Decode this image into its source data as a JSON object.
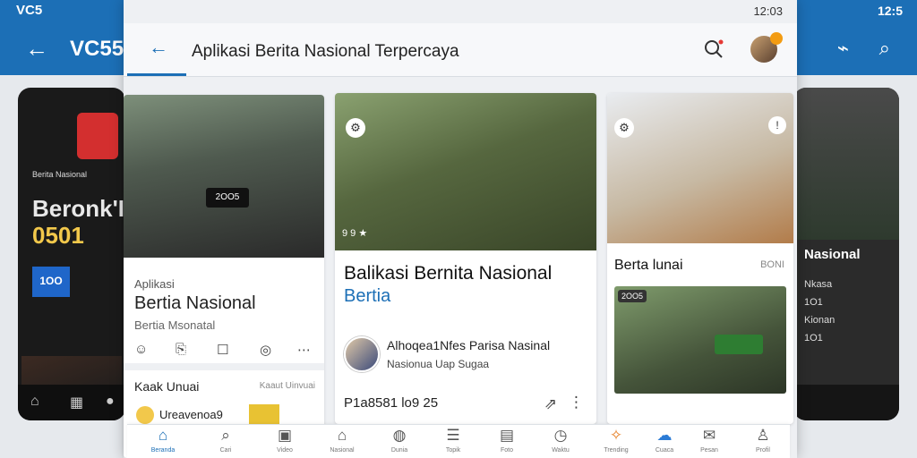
{
  "background_app": {
    "status_left": "VC5",
    "status_right": "12:5",
    "title": "VC55",
    "left_phone": {
      "brand_line": "Berita Nasional",
      "big_text_1": "Beronk'I",
      "big_text_2": "0501",
      "tag": "1OO"
    },
    "right_phone": {
      "title": "Nasional",
      "lines": [
        "Nkasa",
        "1O1",
        "Kionan",
        "1O1"
      ]
    }
  },
  "status": {
    "time": "12:03"
  },
  "header": {
    "title": "Aplikasi Berita Nasional Terpercaya"
  },
  "cards": {
    "left": {
      "screen_text": "2OO5",
      "kicker": "Aplikasi",
      "title": "Bertia Nasional",
      "subtitle": "Bertia Msonatal",
      "section_title": "Kaak Unuai",
      "section_right": "Kaaut Uinvuai",
      "item_text": "Ureavenoa9"
    },
    "middle": {
      "mini_overlay": "9 9 ★",
      "headline": "Balikasi Bernita Nasional",
      "headline_sub": "Bertia",
      "author_line_1": "Alhoqea1Nfes Parisa Nasinal",
      "author_line_2": "Nasionua Uap Sugaa",
      "meta": "P1a8581 lo9 25"
    },
    "right": {
      "heading": "Berta lunai",
      "heading_right": "BONI",
      "chip": "2OO5"
    }
  },
  "tabbar": {
    "items": [
      {
        "label": "Beranda",
        "icon": "home-icon"
      },
      {
        "label": "Cari",
        "icon": "search-icon"
      },
      {
        "label": "Video",
        "icon": "video-icon"
      },
      {
        "label": "Nasional",
        "icon": "landmark-icon"
      },
      {
        "label": "Dunia",
        "icon": "globe-icon"
      },
      {
        "label": "Topik",
        "icon": "list-icon"
      },
      {
        "label": "Foto",
        "icon": "photo-icon"
      },
      {
        "label": "Waktu",
        "icon": "clock-icon"
      },
      {
        "label": "Trending",
        "icon": "trend-icon"
      },
      {
        "label": "Cuaca",
        "icon": "weather-icon"
      },
      {
        "label": "Pesan",
        "icon": "message-icon"
      },
      {
        "label": "Profil",
        "icon": "user-icon"
      }
    ]
  },
  "colors": {
    "accent": "#1c6fb6",
    "notification": "#f39c12"
  }
}
